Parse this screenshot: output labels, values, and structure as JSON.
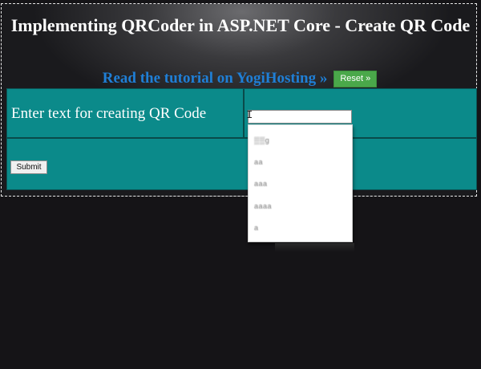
{
  "header": {
    "title": "Implementing QRCoder in ASP.NET Core - Create QR Code",
    "tutorial_link": "Read the tutorial on YogiHosting »",
    "reset_label": "Reset »"
  },
  "form": {
    "label": "Enter text for creating QR Code",
    "input_value": "",
    "submit_label": "Submit"
  },
  "autocomplete": {
    "items": [
      "▒▒g",
      "aa",
      "aaa",
      "aaaa",
      "a"
    ]
  },
  "colors": {
    "background": "#151417",
    "table": "#0b8a8a",
    "link": "#1f7fd6",
    "reset_button": "#4aa84a"
  }
}
